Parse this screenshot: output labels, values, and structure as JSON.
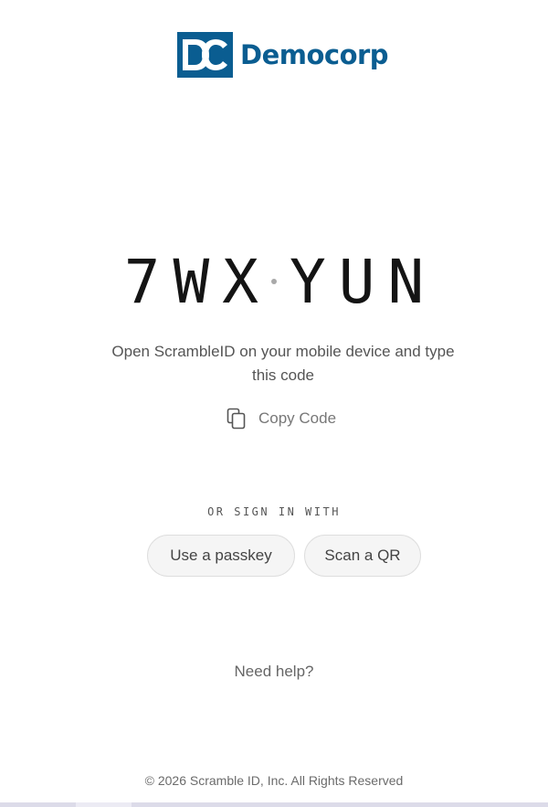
{
  "brand": {
    "name": "Democorp",
    "mark_letters": "DC",
    "color": "#0a5d91"
  },
  "code": {
    "part1": "7WX",
    "part2": "YUN"
  },
  "instructions": "Open ScrambleID on your mobile device and type this code",
  "copy": {
    "label": "Copy Code",
    "icon": "copy-icon"
  },
  "alt_sign_in": {
    "heading": "OR SIGN IN WITH",
    "passkey_label": "Use a passkey",
    "qr_label": "Scan a QR"
  },
  "help": {
    "label": "Need help?"
  },
  "footer": {
    "copyright": "© 2026 Scramble ID, Inc. All Rights Reserved"
  },
  "colors": {
    "code_text": "#141414",
    "button_bg": "#f5f5f5",
    "button_border": "#dedede"
  }
}
